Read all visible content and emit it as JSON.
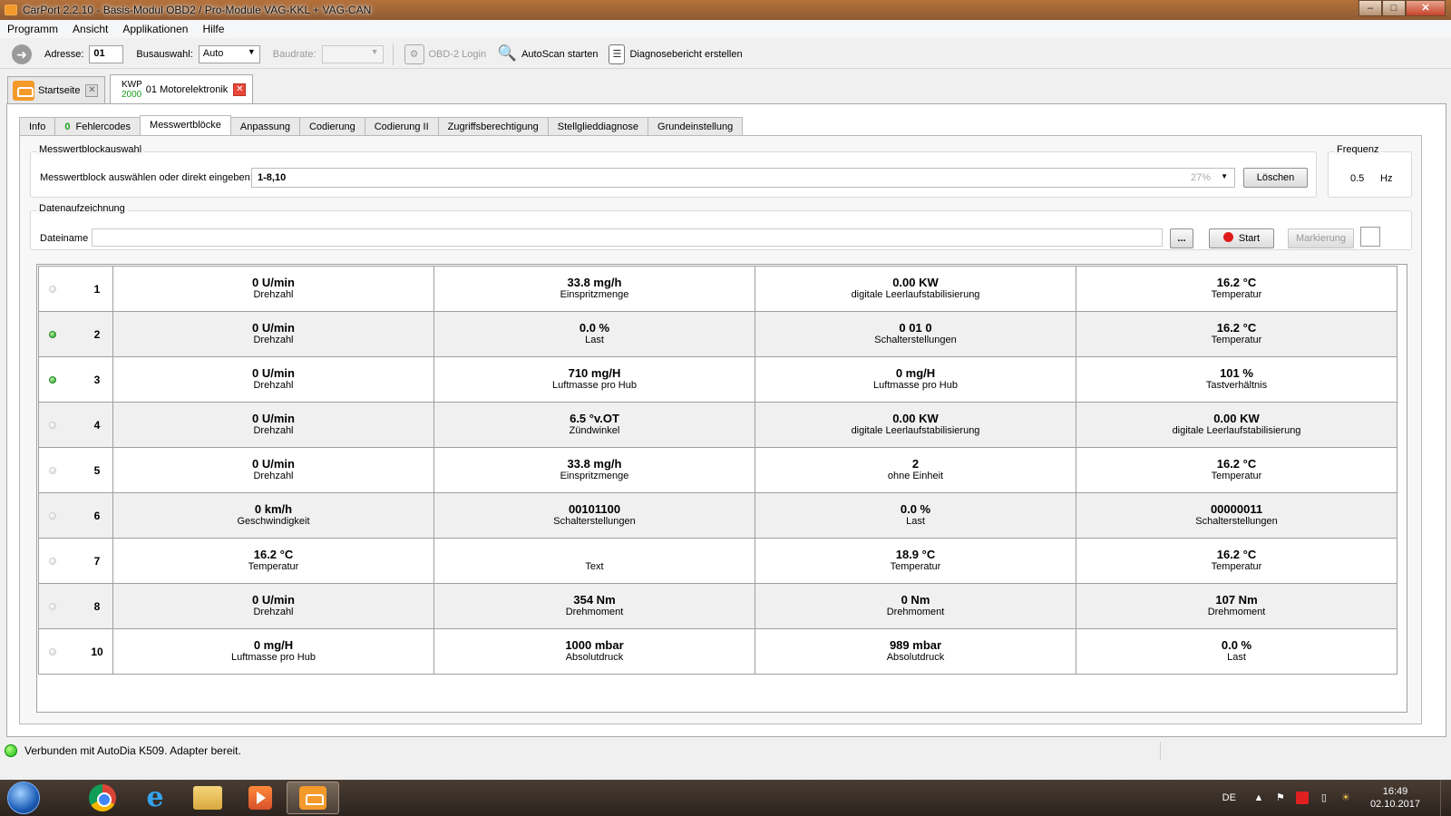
{
  "window": {
    "title": "CarPort 2.2.10 - Basis-Modul OBD2 / Pro-Module VAG-KKL + VAG-CAN",
    "min_label": "–",
    "max_label": "□",
    "close_label": "✕"
  },
  "menu": [
    "Programm",
    "Ansicht",
    "Applikationen",
    "Hilfe"
  ],
  "toolbar": {
    "address_label": "Adresse:",
    "address_value": "01",
    "bus_label": "Busauswahl:",
    "bus_value": "Auto",
    "baud_label": "Baudrate:",
    "baud_value": "",
    "obd_login": "OBD-2 Login",
    "autoscan": "AutoScan starten",
    "report": "Diagnosebericht erstellen"
  },
  "doc_tabs": {
    "home_label": "Startseite",
    "protocol_top": "KWP",
    "protocol_num": "2000",
    "module_label": "01 Motorelektronik",
    "close_glyph": "✕"
  },
  "sub_tabs": {
    "info": "Info",
    "fault_count": "0",
    "faults": "Fehlercodes",
    "blocks": "Messwertblöcke",
    "adapt": "Anpassung",
    "coding": "Codierung",
    "coding2": "Codierung II",
    "access": "Zugriffsberechtigung",
    "actuator": "Stellglieddiagnose",
    "basic": "Grundeinstellung"
  },
  "block_selection": {
    "group_title": "Messwertblockauswahl",
    "prompt": "Messwertblock auswählen oder direkt eingeben:",
    "value": "1-8,10",
    "percent": "27%",
    "clear_button": "Löschen"
  },
  "frequency": {
    "group_title": "Frequenz",
    "value": "0.5",
    "unit": "Hz"
  },
  "recording": {
    "group_title": "Datenaufzeichnung",
    "file_label": "Dateiname",
    "file_value": "",
    "browse_button": "...",
    "start_button": "Start",
    "mark_button": "Markierung"
  },
  "rows": [
    {
      "num": "1",
      "active": false,
      "cells": [
        {
          "v": "0 U/min",
          "d": "Drehzahl"
        },
        {
          "v": "33.8 mg/h",
          "d": "Einspritzmenge"
        },
        {
          "v": "0.00 KW",
          "d": "digitale Leerlaufstabilisierung"
        },
        {
          "v": "16.2 °C",
          "d": "Temperatur"
        }
      ]
    },
    {
      "num": "2",
      "active": true,
      "cells": [
        {
          "v": "0 U/min",
          "d": "Drehzahl"
        },
        {
          "v": "0.0 %",
          "d": "Last"
        },
        {
          "v": "0 01  0",
          "d": "Schalterstellungen"
        },
        {
          "v": "16.2 °C",
          "d": "Temperatur"
        }
      ]
    },
    {
      "num": "3",
      "active": true,
      "cells": [
        {
          "v": "0 U/min",
          "d": "Drehzahl"
        },
        {
          "v": "710 mg/H",
          "d": "Luftmasse pro Hub"
        },
        {
          "v": "0 mg/H",
          "d": "Luftmasse pro Hub"
        },
        {
          "v": "101 %",
          "d": "Tastverhältnis"
        }
      ]
    },
    {
      "num": "4",
      "active": false,
      "cells": [
        {
          "v": "0 U/min",
          "d": "Drehzahl"
        },
        {
          "v": "6.5 °v.OT",
          "d": "Zündwinkel"
        },
        {
          "v": "0.00 KW",
          "d": "digitale Leerlaufstabilisierung"
        },
        {
          "v": "0.00 KW",
          "d": "digitale Leerlaufstabilisierung"
        }
      ]
    },
    {
      "num": "5",
      "active": false,
      "cells": [
        {
          "v": "0 U/min",
          "d": "Drehzahl"
        },
        {
          "v": "33.8 mg/h",
          "d": "Einspritzmenge"
        },
        {
          "v": "2",
          "d": "ohne Einheit"
        },
        {
          "v": "16.2 °C",
          "d": "Temperatur"
        }
      ]
    },
    {
      "num": "6",
      "active": false,
      "cells": [
        {
          "v": "0 km/h",
          "d": "Geschwindigkeit"
        },
        {
          "v": "00101100",
          "d": "Schalterstellungen"
        },
        {
          "v": "0.0 %",
          "d": "Last"
        },
        {
          "v": "00000011",
          "d": "Schalterstellungen"
        }
      ]
    },
    {
      "num": "7",
      "active": false,
      "cells": [
        {
          "v": "16.2 °C",
          "d": "Temperatur"
        },
        {
          "v": "",
          "d": "Text"
        },
        {
          "v": "18.9 °C",
          "d": "Temperatur"
        },
        {
          "v": "16.2 °C",
          "d": "Temperatur"
        }
      ]
    },
    {
      "num": "8",
      "active": false,
      "cells": [
        {
          "v": "0 U/min",
          "d": "Drehzahl"
        },
        {
          "v": "354 Nm",
          "d": "Drehmoment"
        },
        {
          "v": "0 Nm",
          "d": "Drehmoment"
        },
        {
          "v": "107 Nm",
          "d": "Drehmoment"
        }
      ]
    },
    {
      "num": "10",
      "active": false,
      "cells": [
        {
          "v": "0 mg/H",
          "d": "Luftmasse pro Hub"
        },
        {
          "v": "1000 mbar",
          "d": "Absolutdruck"
        },
        {
          "v": "989 mbar",
          "d": "Absolutdruck"
        },
        {
          "v": "0.0 %",
          "d": "Last"
        }
      ]
    }
  ],
  "status": {
    "text": "Verbunden mit AutoDia K509. Adapter bereit."
  },
  "taskbar": {
    "ie_glyph": "e",
    "language": "DE",
    "time": "16:49",
    "date": "02.10.2017",
    "tray_up": "▲",
    "tray_flag": "⚑",
    "tray_battery": "▯",
    "tray_sun": "☀"
  }
}
